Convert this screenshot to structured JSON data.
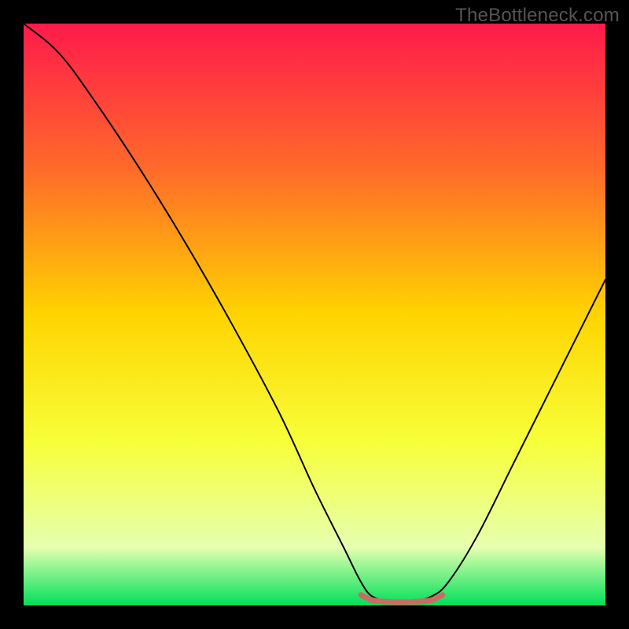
{
  "watermark": "TheBottleneck.com",
  "chart_data": {
    "type": "line",
    "title": "",
    "xlabel": "",
    "ylabel": "",
    "xlim": [
      0,
      100
    ],
    "ylim": [
      0,
      100
    ],
    "gradient_stops": [
      {
        "offset": 0,
        "color": "#ff1a4b"
      },
      {
        "offset": 25,
        "color": "#ff6a2a"
      },
      {
        "offset": 50,
        "color": "#ffd400"
      },
      {
        "offset": 72,
        "color": "#f7ff3a"
      },
      {
        "offset": 90,
        "color": "#e6ffb0"
      },
      {
        "offset": 100,
        "color": "#00e05a"
      }
    ],
    "series": [
      {
        "name": "curve",
        "color": "#000000",
        "width": 2,
        "points": [
          {
            "x": 0,
            "y": 100
          },
          {
            "x": 6,
            "y": 95
          },
          {
            "x": 12,
            "y": 87
          },
          {
            "x": 20,
            "y": 75
          },
          {
            "x": 28,
            "y": 62
          },
          {
            "x": 36,
            "y": 48
          },
          {
            "x": 44,
            "y": 33
          },
          {
            "x": 50,
            "y": 20
          },
          {
            "x": 55,
            "y": 10
          },
          {
            "x": 58,
            "y": 4
          },
          {
            "x": 60,
            "y": 1.5
          },
          {
            "x": 63,
            "y": 0.8
          },
          {
            "x": 67,
            "y": 0.8
          },
          {
            "x": 70,
            "y": 1.5
          },
          {
            "x": 73,
            "y": 4
          },
          {
            "x": 78,
            "y": 12
          },
          {
            "x": 84,
            "y": 24
          },
          {
            "x": 90,
            "y": 36
          },
          {
            "x": 96,
            "y": 48
          },
          {
            "x": 100,
            "y": 56
          }
        ]
      },
      {
        "name": "highlight",
        "color": "#cc6b63",
        "width": 7,
        "points": [
          {
            "x": 58,
            "y": 1.8
          },
          {
            "x": 60,
            "y": 0.9
          },
          {
            "x": 63,
            "y": 0.6
          },
          {
            "x": 67,
            "y": 0.6
          },
          {
            "x": 70,
            "y": 0.9
          },
          {
            "x": 72,
            "y": 1.8
          }
        ]
      }
    ]
  }
}
